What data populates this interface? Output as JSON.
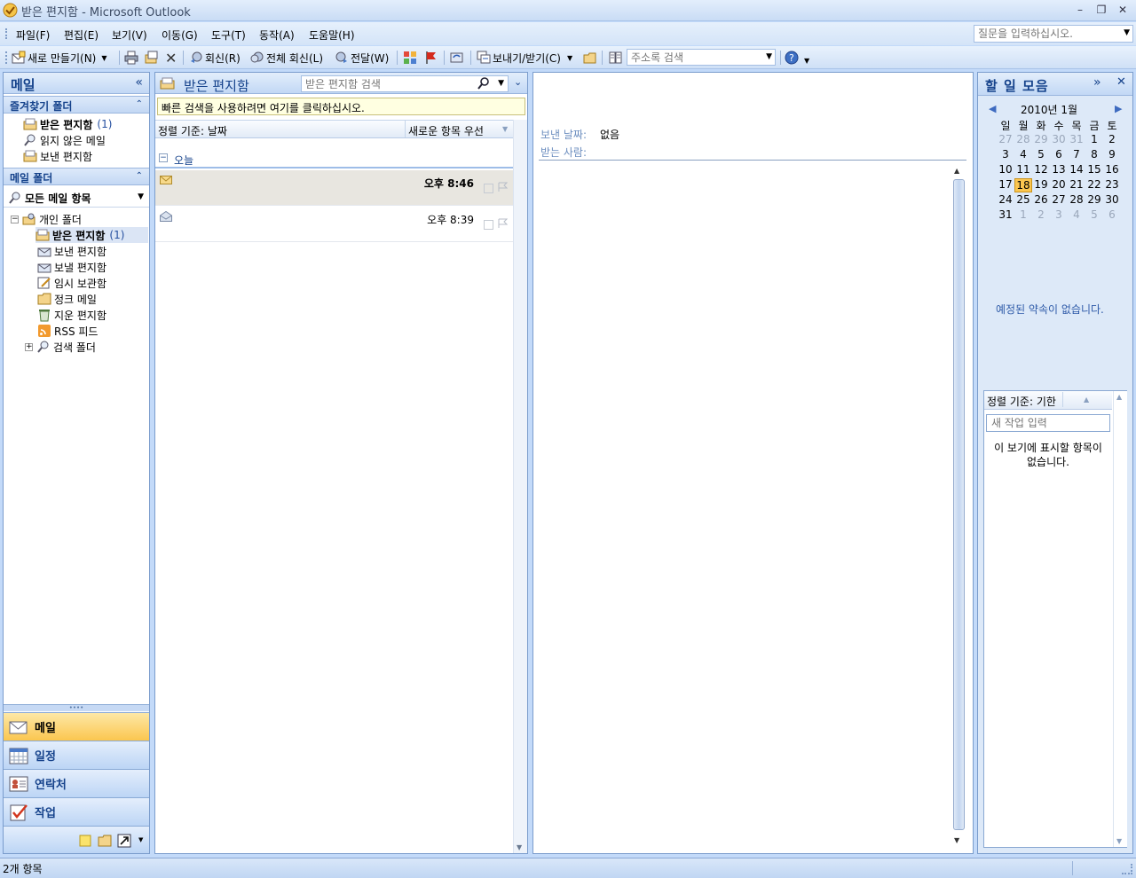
{
  "window": {
    "title": "받은 편지함 - Microsoft Outlook"
  },
  "menu": [
    "파일(F)",
    "편집(E)",
    "보기(V)",
    "이동(G)",
    "도구(T)",
    "동작(A)",
    "도움말(H)"
  ],
  "help_placeholder": "질문을 입력하십시오.",
  "toolbar": {
    "new_label": "새로 만들기(N)",
    "reply_label": "회신(R)",
    "reply_all_label": "전체 회신(L)",
    "forward_label": "전달(W)",
    "send_receive_label": "보내기/받기(C)",
    "address_search_placeholder": "주소록 검색"
  },
  "nav": {
    "title": "메일",
    "favorites_header": "즐겨찾기 폴더",
    "favorites": [
      {
        "label": "받은 편지함",
        "count": "(1)"
      },
      {
        "label": "읽지 않은 메일"
      },
      {
        "label": "보낸 편지함"
      }
    ],
    "mail_folders_header": "메일 폴더",
    "all_mail_label": "모든 메일 항목",
    "root_label": "개인 폴더",
    "folders": [
      {
        "label": "받은 편지함",
        "count": "(1)"
      },
      {
        "label": "보낸 편지함"
      },
      {
        "label": "보낼 편지함"
      },
      {
        "label": "임시 보관함"
      },
      {
        "label": "정크 메일"
      },
      {
        "label": "지운 편지함"
      },
      {
        "label": "RSS 피드"
      },
      {
        "label": "검색 폴더"
      }
    ],
    "buttons": [
      "메일",
      "일정",
      "연락처",
      "작업"
    ]
  },
  "list": {
    "title": "받은 편지함",
    "search_placeholder": "받은 편지함 검색",
    "quick_search_hint": "빠른 검색을 사용하려면 여기를 클릭하십시오.",
    "sort_label": "정렬 기준: 날짜",
    "sort_order": "새로운 항목 우선",
    "group_label": "오늘",
    "messages": [
      {
        "time": "오후 8:46",
        "unread": true
      },
      {
        "time": "오후 8:39",
        "unread": false
      }
    ]
  },
  "reader": {
    "sent_label": "보낸 날짜:",
    "sent_value": "없음",
    "to_label": "받는 사람:"
  },
  "todo": {
    "title": "할 일 모음",
    "month": "2010년 1월",
    "weekdays": [
      "일",
      "월",
      "화",
      "수",
      "목",
      "금",
      "토"
    ],
    "days": [
      [
        "27",
        "28",
        "29",
        "30",
        "31",
        "1",
        "2"
      ],
      [
        "3",
        "4",
        "5",
        "6",
        "7",
        "8",
        "9"
      ],
      [
        "10",
        "11",
        "12",
        "13",
        "14",
        "15",
        "16"
      ],
      [
        "17",
        "18",
        "19",
        "20",
        "21",
        "22",
        "23"
      ],
      [
        "24",
        "25",
        "26",
        "27",
        "28",
        "29",
        "30"
      ],
      [
        "31",
        "1",
        "2",
        "3",
        "4",
        "5",
        "6"
      ]
    ],
    "today": "18",
    "no_appointments": "예정된 약속이 없습니다.",
    "task_sort_label": "정렬 기준: 기한",
    "new_task_placeholder": "새 작업 입력",
    "no_items": "이 보기에 표시할 항목이 없습니다."
  },
  "status": {
    "items_count": "2개 항목"
  },
  "colors": {
    "accent": "#15428b",
    "active_nav": "#fbc64f",
    "frame": "#c3daf9"
  }
}
